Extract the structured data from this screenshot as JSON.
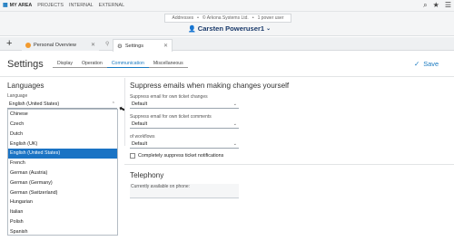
{
  "topbar": {
    "my_area": "MY AREA",
    "projects": "PROJECTS",
    "internal": "INTERNAL",
    "external": "EXTERNAL"
  },
  "breadcrumb": {
    "addresses": "Addresses",
    "company": "© Arkona Systems Ltd.",
    "power_user": "1 power user",
    "user_name": "Carsten Poweruser1"
  },
  "tabs": [
    {
      "label": "Personal Overview"
    },
    {
      "label": "Settings"
    }
  ],
  "settings": {
    "title": "Settings",
    "subtabs": [
      "Display",
      "Operation",
      "Communication",
      "Miscellaneous"
    ],
    "active_subtab": "Communication",
    "save_label": "Save"
  },
  "languages": {
    "title": "Languages",
    "label": "Language",
    "value": "English (United States)",
    "options": [
      "Chinese",
      "Czech",
      "Dutch",
      "English (UK)",
      "English (United States)",
      "French",
      "German (Austria)",
      "German (Germany)",
      "German (Switzerland)",
      "Hungarian",
      "Italian",
      "Polish",
      "Spanish"
    ],
    "selected_index": 4
  },
  "suppress": {
    "title": "Suppress emails when making changes yourself",
    "field1_label": "Suppress email for own ticket changes",
    "field1_value": "Default",
    "field2_label": "Suppress email for own ticket comments",
    "field2_value": "Default",
    "field3_label": "of workflows",
    "field3_value": "Default",
    "checkbox_label": "Completely suppress ticket notifications"
  },
  "telephony": {
    "title": "Telephony",
    "field_label": "Currently available on phone:"
  },
  "colors": {
    "accent": "#1a7ac0",
    "selected": "#1a73c4",
    "tab_dot": "#f29a2e"
  }
}
